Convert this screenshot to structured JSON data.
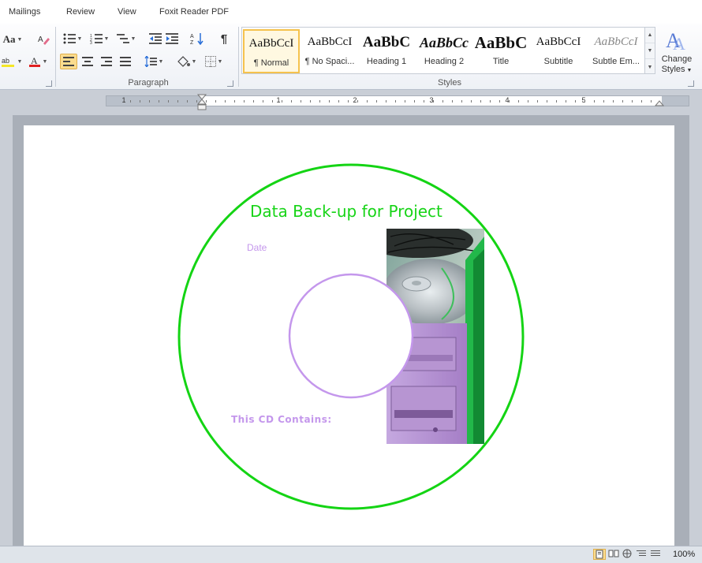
{
  "menu": {
    "tabs": [
      "Mailings",
      "Review",
      "View",
      "Foxit Reader PDF"
    ]
  },
  "ribbon": {
    "groups": {
      "paragraph": "Paragraph",
      "styles": "Styles"
    },
    "change_styles": [
      "Change",
      "Styles"
    ],
    "font_size_icon": "Aa",
    "styles": [
      {
        "preview": "AaBbCcI",
        "name": "¶ Normal",
        "selected": true
      },
      {
        "preview": "AaBbCcI",
        "name": "¶ No Spaci..."
      },
      {
        "preview": "AaBbC",
        "name": "Heading 1"
      },
      {
        "preview": "AaBbCc",
        "name": "Heading 2"
      },
      {
        "preview": "AaBbC",
        "name": "Title"
      },
      {
        "preview": "AaBbCcI",
        "name": "Subtitle"
      },
      {
        "preview": "AaBbCcI",
        "name": "Subtle Em..."
      }
    ]
  },
  "ruler": {
    "numbers": [
      "1",
      "1",
      "2",
      "3",
      "4",
      "5"
    ]
  },
  "document": {
    "title": "Data Back-up for Project",
    "date_label": "Date",
    "contains_label": "This CD Contains:"
  },
  "colors": {
    "outer_ring": "#14d414",
    "inner_ring": "#c497ec",
    "title": "#17d417",
    "label_text": "#c497ec"
  },
  "status": {
    "zoom": "100%"
  }
}
